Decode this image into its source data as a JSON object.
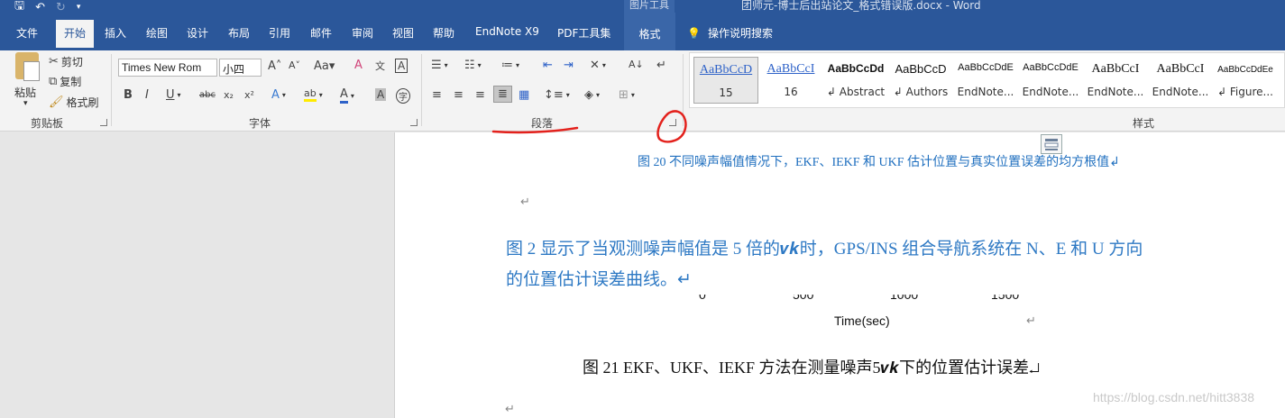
{
  "titlebar": {
    "context_title": "图片工具",
    "doc_title": "团师元-博士后出站论文_格式错误版.docx - Word"
  },
  "tabs": {
    "file": "文件",
    "home": "开始",
    "insert": "插入",
    "draw": "绘图",
    "design": "设计",
    "layout": "布局",
    "references": "引用",
    "mailings": "邮件",
    "review": "审阅",
    "view": "视图",
    "help": "帮助",
    "endnote": "EndNote X9",
    "pdf": "PDF工具集",
    "format": "格式",
    "tell_me": "操作说明搜索"
  },
  "clipboard": {
    "paste": "粘贴",
    "cut": "剪切",
    "copy": "复制",
    "format_painter": "格式刷",
    "label": "剪贴板"
  },
  "font": {
    "font_name": "Times New Rom",
    "font_size": "小四",
    "label": "字体"
  },
  "paragraph": {
    "label": "段落"
  },
  "styles": {
    "label": "样式",
    "items": [
      {
        "sample": "AaBbCcD",
        "name": "15"
      },
      {
        "sample": "AaBbCcI",
        "name": "16"
      },
      {
        "sample": "AaBbCcDd",
        "name": "↲ Abstract"
      },
      {
        "sample": "AaBbCcD",
        "name": "↲ Authors"
      },
      {
        "sample": "AaBbCcDdE",
        "name": "EndNote..."
      },
      {
        "sample": "AaBbCcDdE",
        "name": "EndNote..."
      },
      {
        "sample": "AaBbCcI",
        "name": "EndNote..."
      },
      {
        "sample": "AaBbCcI",
        "name": "EndNote..."
      },
      {
        "sample": "AaBbCcDdEe",
        "name": "↲ Figure..."
      }
    ]
  },
  "document": {
    "caption_top": "图 20  不同噪声幅值情况下，EKF、IEKF 和 UKF 估计位置与真实位置误差的均方根值↲",
    "para_mark": "↵",
    "body_line1": "图 2 显示了当观测噪声幅值是 5 倍的𝒗𝒌时，GPS/INS 组合导航系统在 N、E 和 U 方向",
    "body_line2": "的位置估计误差曲线。↵",
    "axis_ticks": [
      "0",
      "500",
      "1000",
      "1500"
    ],
    "axis_label": "Time(sec)",
    "caption_bottom": "图 21 EKF、UKF、IEKF 方法在测量噪声5𝒗𝒌下的位置估计误差↵",
    "watermark": "https://blog.csdn.net/hitt3838"
  },
  "colors": {
    "ribbon_blue": "#2b579a",
    "annotation_red": "#e3211c",
    "body_text_blue": "#2e79c4"
  }
}
